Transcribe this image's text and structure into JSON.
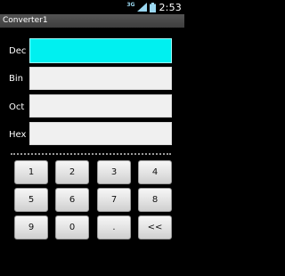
{
  "status_bar": {
    "network_type": "3G",
    "signal_icon": "signal-icon",
    "battery_icon": "battery-icon",
    "time": "2:53"
  },
  "app": {
    "title": "Converter1"
  },
  "fields": [
    {
      "label": "Dec",
      "value": ""
    },
    {
      "label": "Bin",
      "value": ""
    },
    {
      "label": "Oct",
      "value": ""
    },
    {
      "label": "Hex",
      "value": ""
    }
  ],
  "keypad": {
    "keys": [
      "1",
      "2",
      "3",
      "4",
      "5",
      "6",
      "7",
      "8",
      "9",
      "0",
      ".",
      "<<"
    ]
  },
  "colors": {
    "active_field": "#00f0f0",
    "inactive_field": "#f0f0f0",
    "background": "#000000"
  }
}
